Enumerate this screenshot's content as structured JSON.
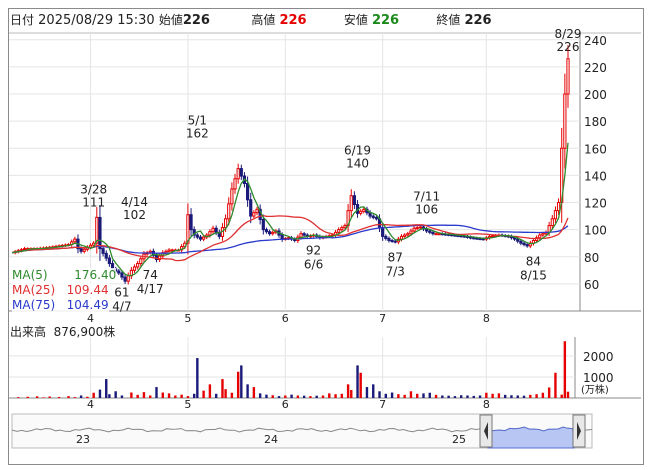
{
  "header": {
    "date_label": "日付",
    "datetime": "2025/08/29 15:30",
    "open_label": "始値",
    "open": "226",
    "high_label": "高値",
    "high": "226",
    "low_label": "安値",
    "low": "226",
    "close_label": "終値",
    "close": "226"
  },
  "ma_legend": [
    {
      "label": "MA(5)",
      "value": "176.40",
      "color": "#2e8b2e"
    },
    {
      "label": "MA(25)",
      "value": "109.44",
      "color": "#e03030"
    },
    {
      "label": "MA(75)",
      "value": "104.49",
      "color": "#2a3acc"
    }
  ],
  "volume_header": {
    "label": "出来高",
    "value": "876,900株"
  },
  "colors": {
    "up": "#e60000",
    "down": "#1a1a7a",
    "ma5": "#2e8b2e",
    "ma25": "#e03030",
    "ma75": "#2a3acc",
    "volume_up": "#e60000",
    "volume_down": "#1a1a7a",
    "overview_fill": "#b7c6f2"
  },
  "chart_data": [
    {
      "type": "candlestick",
      "y_axis_side": "right",
      "ylim": [
        40,
        245
      ],
      "y_ticks": [
        60,
        80,
        100,
        120,
        140,
        160,
        180,
        200,
        220,
        240
      ],
      "x_month_labels": [
        "4",
        "5",
        "6",
        "7",
        "8"
      ],
      "x_month_label_days": [
        25,
        56,
        87,
        118,
        151
      ],
      "last_day": 177,
      "series": [
        {
          "name": "price",
          "close_path": [
            [
              0,
              83
            ],
            [
              4,
              86
            ],
            [
              8,
              86
            ],
            [
              12,
              87
            ],
            [
              15,
              88
            ],
            [
              18,
              89
            ],
            [
              20,
              93
            ],
            [
              21,
              86
            ],
            [
              22,
              84
            ],
            [
              24,
              87
            ],
            [
              26,
              90
            ],
            [
              27,
              109
            ],
            [
              28,
              86
            ],
            [
              30,
              79
            ],
            [
              32,
              71
            ],
            [
              34,
              68
            ],
            [
              36,
              62
            ],
            [
              38,
              70
            ],
            [
              40,
              75
            ],
            [
              42,
              82
            ],
            [
              44,
              84
            ],
            [
              46,
              78
            ],
            [
              48,
              83
            ],
            [
              50,
              85
            ],
            [
              53,
              85
            ],
            [
              55,
              90
            ],
            [
              56,
              111
            ],
            [
              57,
              100
            ],
            [
              58,
              96
            ],
            [
              60,
              93
            ],
            [
              62,
              96
            ],
            [
              64,
              101
            ],
            [
              66,
              95
            ],
            [
              68,
              108
            ],
            [
              70,
              130
            ],
            [
              72,
              145
            ],
            [
              74,
              134
            ],
            [
              76,
              110
            ],
            [
              78,
              115
            ],
            [
              80,
              100
            ],
            [
              82,
              97
            ],
            [
              84,
              99
            ],
            [
              86,
              93
            ],
            [
              88,
              94
            ],
            [
              90,
              92
            ],
            [
              92,
              97
            ],
            [
              94,
              95
            ],
            [
              96,
              96
            ],
            [
              98,
              94
            ],
            [
              100,
              95
            ],
            [
              102,
              96
            ],
            [
              104,
              100
            ],
            [
              106,
              103
            ],
            [
              108,
              125
            ],
            [
              110,
              112
            ],
            [
              112,
              115
            ],
            [
              114,
              110
            ],
            [
              116,
              108
            ],
            [
              118,
              95
            ],
            [
              120,
              92
            ],
            [
              122,
              91
            ],
            [
              124,
              95
            ],
            [
              126,
              97
            ],
            [
              128,
              101
            ],
            [
              130,
              102
            ],
            [
              132,
              99
            ],
            [
              134,
              97
            ],
            [
              136,
              97
            ],
            [
              140,
              96
            ],
            [
              144,
              95
            ],
            [
              146,
              94
            ],
            [
              150,
              93
            ],
            [
              152,
              95
            ],
            [
              155,
              96
            ],
            [
              158,
              95
            ],
            [
              160,
              93
            ],
            [
              162,
              90
            ],
            [
              164,
              88
            ],
            [
              166,
              92
            ],
            [
              168,
              96
            ],
            [
              170,
              98
            ],
            [
              172,
              108
            ],
            [
              174,
              120
            ],
            [
              175,
              160
            ],
            [
              176,
              200
            ],
            [
              177,
              226
            ]
          ]
        },
        {
          "name": "MA(5)",
          "color": "#2e8b2e"
        },
        {
          "name": "MA(25)",
          "color": "#e03030"
        },
        {
          "name": "MA(75)",
          "color": "#2a3acc"
        }
      ],
      "annotations": [
        {
          "day": 26,
          "label_date": "3/28",
          "label_value": "111",
          "position": "above"
        },
        {
          "day": 39,
          "label_date": "4/14",
          "label_value": "102",
          "position": "above"
        },
        {
          "day": 59,
          "label_date": "5/1",
          "label_value": "162",
          "position": "above"
        },
        {
          "day": 110,
          "label_date": "6/19",
          "label_value": "140",
          "position": "above"
        },
        {
          "day": 132,
          "label_date": "7/11",
          "label_value": "106",
          "position": "above"
        },
        {
          "day": 177,
          "label_date": "8/29",
          "label_value": "226",
          "position": "above"
        },
        {
          "day": 35,
          "label_date": "4/7",
          "label_value": "61",
          "position": "below"
        },
        {
          "day": 44,
          "label_date": "4/17",
          "label_value": "74",
          "position": "below"
        },
        {
          "day": 96,
          "label_date": "6/6",
          "label_value": "92",
          "position": "below"
        },
        {
          "day": 122,
          "label_date": "7/3",
          "label_value": "87",
          "position": "below"
        },
        {
          "day": 166,
          "label_date": "8/15",
          "label_value": "84",
          "position": "below"
        }
      ]
    },
    {
      "type": "bar",
      "y_ticks": [
        1000,
        2000
      ],
      "unit_label": "(万株)",
      "ylim": [
        0,
        2900
      ],
      "x_month_labels": [
        "4",
        "5",
        "6",
        "7",
        "8"
      ],
      "bars": [
        [
          2,
          40
        ],
        [
          5,
          60
        ],
        [
          8,
          80
        ],
        [
          10,
          30
        ],
        [
          12,
          70
        ],
        [
          15,
          50
        ],
        [
          18,
          90
        ],
        [
          20,
          40
        ],
        [
          22,
          120
        ],
        [
          24,
          60
        ],
        [
          26,
          250
        ],
        [
          28,
          400
        ],
        [
          30,
          900
        ],
        [
          31,
          180
        ],
        [
          33,
          320
        ],
        [
          35,
          120
        ],
        [
          38,
          260
        ],
        [
          40,
          150
        ],
        [
          42,
          280
        ],
        [
          44,
          120
        ],
        [
          46,
          520
        ],
        [
          48,
          260
        ],
        [
          50,
          220
        ],
        [
          52,
          120
        ],
        [
          54,
          160
        ],
        [
          56,
          90
        ],
        [
          58,
          200
        ],
        [
          59,
          1900
        ],
        [
          61,
          350
        ],
        [
          63,
          650
        ],
        [
          65,
          200
        ],
        [
          67,
          900
        ],
        [
          68,
          420
        ],
        [
          70,
          250
        ],
        [
          72,
          1250
        ],
        [
          73,
          1550
        ],
        [
          75,
          650
        ],
        [
          77,
          520
        ],
        [
          79,
          220
        ],
        [
          81,
          160
        ],
        [
          83,
          130
        ],
        [
          85,
          90
        ],
        [
          87,
          120
        ],
        [
          89,
          160
        ],
        [
          91,
          120
        ],
        [
          93,
          110
        ],
        [
          95,
          90
        ],
        [
          97,
          110
        ],
        [
          99,
          120
        ],
        [
          101,
          220
        ],
        [
          103,
          180
        ],
        [
          105,
          200
        ],
        [
          107,
          650
        ],
        [
          108,
          380
        ],
        [
          110,
          1550
        ],
        [
          111,
          1200
        ],
        [
          113,
          520
        ],
        [
          115,
          650
        ],
        [
          117,
          320
        ],
        [
          119,
          200
        ],
        [
          121,
          260
        ],
        [
          123,
          180
        ],
        [
          125,
          150
        ],
        [
          127,
          320
        ],
        [
          129,
          200
        ],
        [
          131,
          220
        ],
        [
          133,
          250
        ],
        [
          135,
          150
        ],
        [
          137,
          120
        ],
        [
          139,
          110
        ],
        [
          141,
          90
        ],
        [
          143,
          130
        ],
        [
          145,
          120
        ],
        [
          147,
          100
        ],
        [
          149,
          120
        ],
        [
          151,
          250
        ],
        [
          153,
          200
        ],
        [
          155,
          220
        ],
        [
          157,
          150
        ],
        [
          159,
          130
        ],
        [
          161,
          120
        ],
        [
          163,
          110
        ],
        [
          165,
          150
        ],
        [
          167,
          180
        ],
        [
          169,
          250
        ],
        [
          171,
          500
        ],
        [
          173,
          1200
        ],
        [
          175,
          160
        ],
        [
          176,
          2700
        ],
        [
          177,
          300
        ]
      ]
    },
    {
      "type": "area",
      "role": "range-overview",
      "x_labels": [
        "23",
        "24",
        "25"
      ]
    }
  ]
}
